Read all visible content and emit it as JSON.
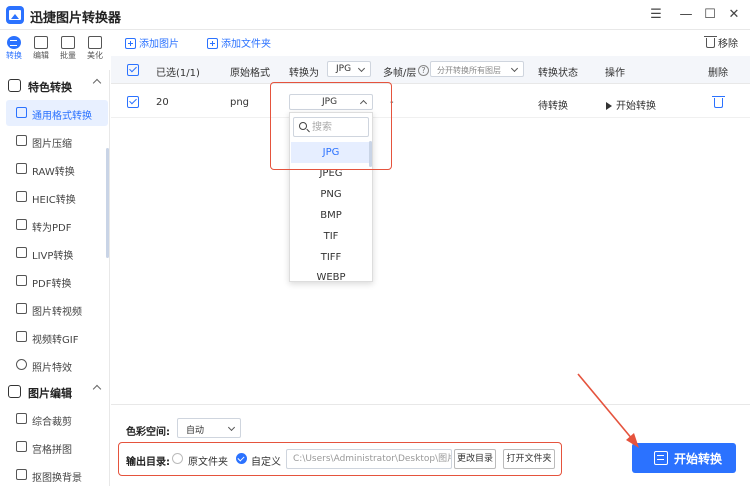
{
  "window": {
    "title": "迅捷图片转换器",
    "menu_glyph": "☰",
    "minimize_glyph": "—",
    "maximize_glyph": "☐",
    "close_glyph": "✕"
  },
  "rail": [
    {
      "label": "转换",
      "icon": "convert-icon",
      "active": true
    },
    {
      "label": "编辑",
      "icon": "edit-icon"
    },
    {
      "label": "批量",
      "icon": "batch-icon"
    },
    {
      "label": "美化",
      "icon": "beautify-icon"
    }
  ],
  "sidebar": {
    "sections": [
      {
        "title": "特色转换",
        "items": [
          {
            "label": "通用格式转换",
            "active": true
          },
          {
            "label": "图片压缩"
          },
          {
            "label": "RAW转换"
          },
          {
            "label": "HEIC转换"
          },
          {
            "label": "转为PDF"
          },
          {
            "label": "LIVP转换"
          },
          {
            "label": "PDF转换"
          },
          {
            "label": "图片转视频"
          },
          {
            "label": "视频转GIF"
          },
          {
            "label": "照片特效"
          }
        ]
      },
      {
        "title": "图片编辑",
        "items": [
          {
            "label": "综合裁剪"
          },
          {
            "label": "宫格拼图"
          },
          {
            "label": "抠图换背景"
          }
        ]
      }
    ]
  },
  "toolbar": {
    "add_image": "添加图片",
    "add_folder": "添加文件夹",
    "remove": "移除"
  },
  "table": {
    "headers": {
      "selected": "已选(1/1)",
      "original_format": "原始格式",
      "convert_to": "转换为",
      "convert_to_value": "JPG",
      "multi_frame": "多帧/层",
      "multi_frame_value": "分开转换所有图层",
      "status": "转换状态",
      "action": "操作",
      "delete": "删除"
    },
    "rows": [
      {
        "name": "20",
        "format": "png",
        "target": "JPG",
        "multi": "-",
        "status": "待转换",
        "action": "开始转换"
      }
    ]
  },
  "dropdown": {
    "search_placeholder": "搜索",
    "options": [
      "JPG",
      "JPEG",
      "PNG",
      "BMP",
      "TIF",
      "TIFF",
      "WEBP"
    ],
    "selected": "JPG"
  },
  "bottom": {
    "color_space_label": "色彩空间:",
    "color_space_value": "自动",
    "output_label": "输出目录:",
    "original_folder": "原文件夹",
    "custom": "自定义",
    "path": "C:\\Users\\Administrator\\Desktop\\图片",
    "change_dir": "更改目录",
    "open_folder": "打开文件夹",
    "start": "开始转换"
  },
  "colors": {
    "accent": "#2b72ff",
    "annotation": "#e5533d"
  }
}
